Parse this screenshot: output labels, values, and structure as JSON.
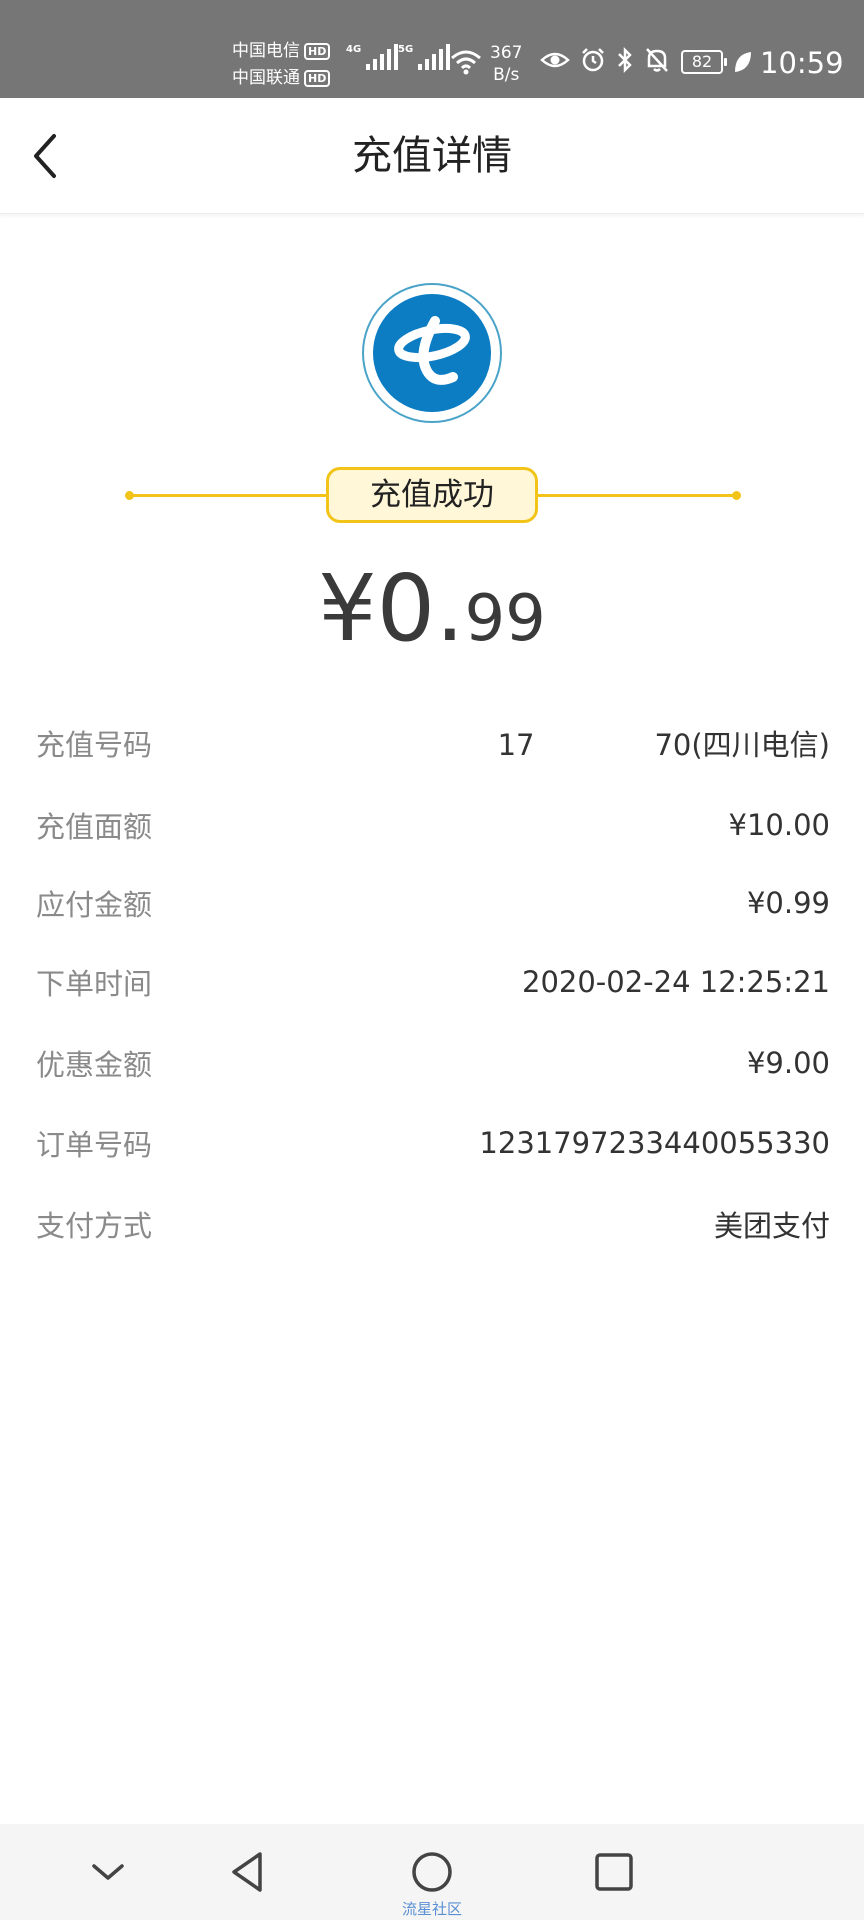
{
  "status_bar": {
    "carrier_1": "中国电信",
    "carrier_2": "中国联通",
    "hd": "HD",
    "network_1": "4G",
    "network_2": "5G",
    "speed_value": "367",
    "speed_unit": "B/s",
    "battery": "82",
    "time": "10:59"
  },
  "header": {
    "title": "充值详情"
  },
  "result": {
    "status": "充值成功",
    "amount_integer": "¥0.",
    "amount_decimal": "99"
  },
  "details": [
    {
      "label": "充值号码",
      "value_prefix": "17",
      "value_suffix": "70(四川电信)"
    },
    {
      "label": "充值面额",
      "value": "¥10.00"
    },
    {
      "label": "应付金额",
      "value": "¥0.99"
    },
    {
      "label": "下单时间",
      "value": "2020-02-24 12:25:21"
    },
    {
      "label": "优惠金额",
      "value": "¥9.00"
    },
    {
      "label": "订单号码",
      "value": "1231797233440055330"
    },
    {
      "label": "支付方式",
      "value": "美团支付"
    }
  ],
  "watermark": "流星社区",
  "colors": {
    "accent": "#f2c418",
    "logo_blue": "#0d7dc3",
    "status_bar": "#767676"
  }
}
